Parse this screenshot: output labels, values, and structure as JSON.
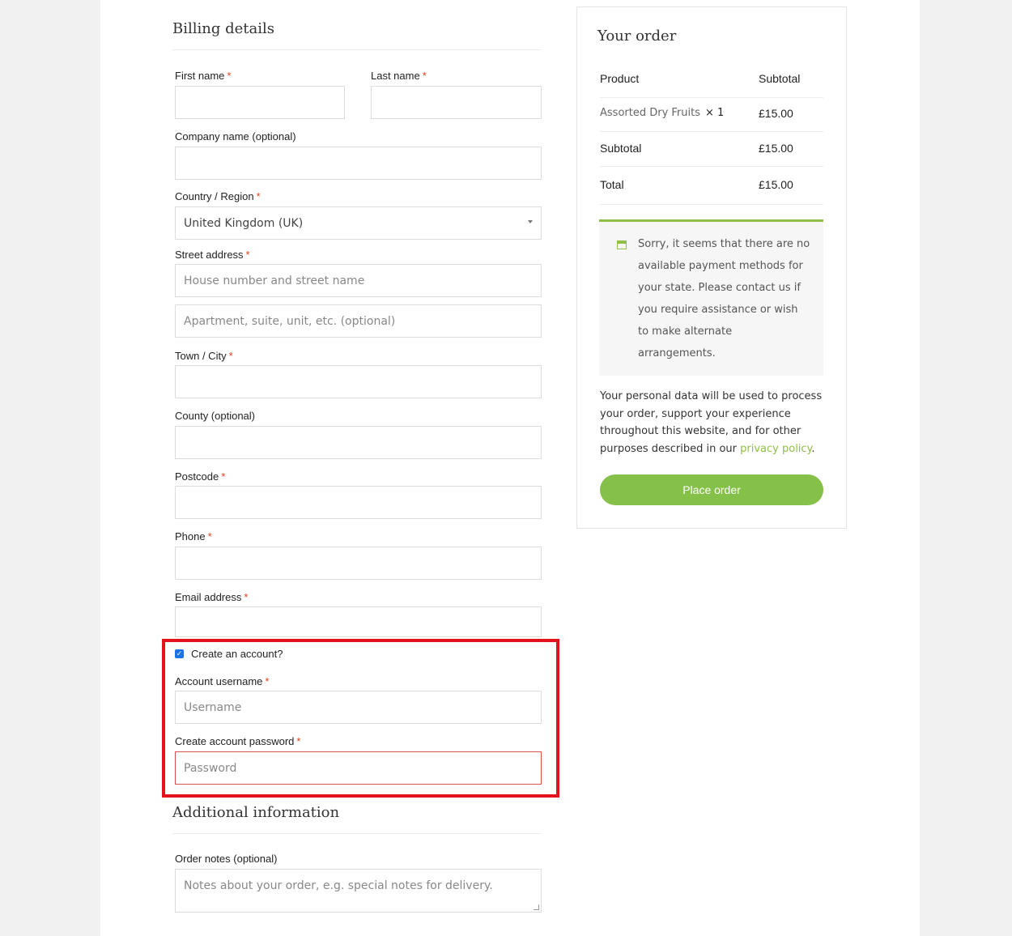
{
  "billing": {
    "title": "Billing details",
    "required_mark": "*",
    "first_name_label": "First name",
    "last_name_label": "Last name",
    "company_label": "Company name (optional)",
    "country_label": "Country / Region",
    "country_value": "United Kingdom (UK)",
    "street_label": "Street address",
    "street_placeholder": "House number and street name",
    "street2_placeholder": "Apartment, suite, unit, etc. (optional)",
    "city_label": "Town / City",
    "county_label": "County (optional)",
    "postcode_label": "Postcode",
    "phone_label": "Phone",
    "email_label": "Email address"
  },
  "account": {
    "create_label": "Create an account?",
    "create_checked": true,
    "checkmark_glyph": "✓",
    "username_label": "Account username",
    "username_placeholder": "Username",
    "password_label": "Create account password",
    "password_placeholder": "Password"
  },
  "additional": {
    "title": "Additional information",
    "notes_label": "Order notes (optional)",
    "notes_placeholder": "Notes about your order, e.g. special notes for delivery."
  },
  "order": {
    "title": "Your order",
    "col_product": "Product",
    "col_subtotal": "Subtotal",
    "item_name": "Assorted Dry Fruits",
    "item_qty": "× 1",
    "item_price": "£15.00",
    "subtotal_label": "Subtotal",
    "subtotal_value": "£15.00",
    "total_label": "Total",
    "total_value": "£15.00",
    "notice": "Sorry, it seems that there are no available payment methods for your state. Please contact us if you require assistance or wish to make alternate arrangements.",
    "privacy_text": "Your personal data will be used to process your order, support your experience throughout this website, and for other purposes described in our",
    "privacy_link": "privacy policy",
    "privacy_end": ".",
    "place_order": "Place order"
  },
  "colors": {
    "accent_green": "#85c148",
    "required_red": "#e2401c",
    "highlight_red": "#e3111b",
    "checkbox_blue": "#1a73e8"
  }
}
